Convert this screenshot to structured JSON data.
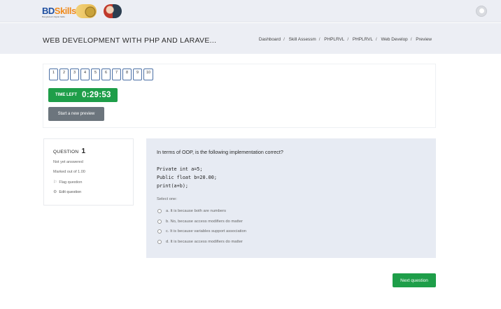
{
  "topbar": {
    "logo_text_main": "BD",
    "logo_text_accent": "Skills",
    "logo_subtext": "Bangladesh Digital Skills"
  },
  "header": {
    "title": "WEB DEVELOPMENT WITH PHP AND LARAVE...",
    "breadcrumb": [
      "Dashboard",
      "Skill Assessm",
      "PHPLRVL",
      "PHPLRVL",
      "Web Develop",
      "Preview"
    ]
  },
  "quiz_nav": {
    "questions": [
      "1",
      "2",
      "3",
      "4",
      "5",
      "6",
      "7",
      "8",
      "9",
      "10"
    ]
  },
  "timer": {
    "label": "TIME LEFT",
    "value": "0:29:53"
  },
  "buttons": {
    "start_preview": "Start a new preview",
    "next_question": "Next question"
  },
  "question_info": {
    "label": "QUESTION",
    "number": "1",
    "state": "Not yet answered",
    "grade": "Marked out of 1.00",
    "flag": "Flag question",
    "edit": "Edit question"
  },
  "question": {
    "text": "In terms of OOP, is the following implementation correct?",
    "code_lines": [
      "Private int a=5;",
      "Public float b=20.00;",
      "print(a+b);"
    ],
    "prompt": "Select one:",
    "answers": [
      "a. It is because both are numbers",
      "b. No, because access modifiers do matter",
      "c. It is because variables support association",
      "d. It is because access modifiers do matter"
    ]
  },
  "colors": {
    "success_green": "#1e9e49",
    "secondary_gray": "#6c757d",
    "content_bg": "#e7ebf3",
    "header_bg": "#eceef4",
    "nav_border": "#4a6fa5"
  }
}
